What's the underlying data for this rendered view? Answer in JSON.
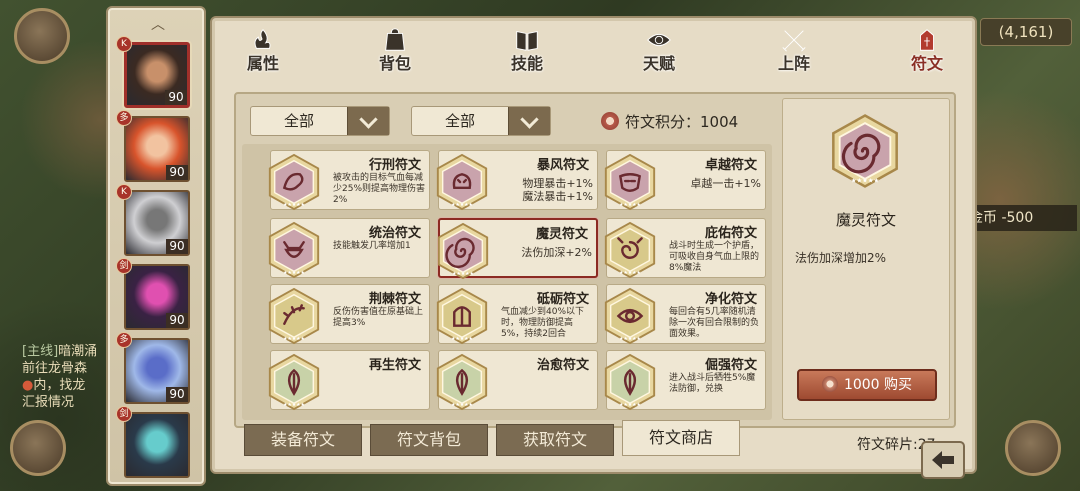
{
  "header": {
    "tabs": [
      {
        "label": "属性",
        "icon": "flame-icon",
        "active": false
      },
      {
        "label": "背包",
        "icon": "backpack-icon",
        "active": false
      },
      {
        "label": "技能",
        "icon": "book-icon",
        "active": false
      },
      {
        "label": "天赋",
        "icon": "eye-icon",
        "active": false
      },
      {
        "label": "上阵",
        "icon": "crossed-swords-icon",
        "active": false
      },
      {
        "label": "符文",
        "icon": "rune-emblem-icon",
        "active": true
      }
    ]
  },
  "background": {
    "quest_tag": "[主线]",
    "quest_title": "暗潮涌",
    "quest_line1": "前往龙骨森",
    "quest_line2": "内，找龙",
    "quest_line3": "汇报情况",
    "gold_readout": "(4,161)",
    "gold_toast": "金币 -500"
  },
  "heroes": [
    {
      "level": "90",
      "badge": "K",
      "selected": true,
      "colors": [
        "#3b2a22",
        "#c8906a"
      ]
    },
    {
      "level": "90",
      "badge": "多",
      "selected": false,
      "colors": [
        "#d8542c",
        "#f2c3a0"
      ]
    },
    {
      "level": "90",
      "badge": "K",
      "selected": false,
      "colors": [
        "#cfcfd2",
        "#777"
      ]
    },
    {
      "level": "90",
      "badge": "剑",
      "selected": false,
      "colors": [
        "#3a2244",
        "#e050b0"
      ]
    },
    {
      "level": "90",
      "badge": "多",
      "selected": false,
      "colors": [
        "#9fb8e8",
        "#5a6dc8"
      ]
    },
    {
      "level": "",
      "badge": "剑",
      "selected": false,
      "colors": [
        "#2a3a4a",
        "#6cc"
      ]
    }
  ],
  "filters": {
    "filter1": "全部",
    "filter2": "全部"
  },
  "points": {
    "label": "符文积分：1004"
  },
  "runes": [
    {
      "name": "行刑符文",
      "desc": "被攻击的目标气血每减少25%则提高物理伤害2%",
      "big": false,
      "color": "#c9a3ac",
      "glyph": "dragon"
    },
    {
      "name": "暴风符文",
      "desc": "物理暴击+1%\n魔法暴击+1%",
      "big": true,
      "color": "#c9a3ac",
      "glyph": "beast"
    },
    {
      "name": "卓越符文",
      "desc": "卓越一击+1%",
      "big": true,
      "color": "#c9a3ac",
      "glyph": "mask"
    },
    {
      "name": "统治符文",
      "desc": "技能触发几率增加1",
      "big": false,
      "color": "#c9a3ac",
      "glyph": "demon"
    },
    {
      "name": "魔灵符文",
      "desc": "法伤加深+2%",
      "big": true,
      "color": "#c9a3ac",
      "glyph": "spiral"
    },
    {
      "name": "庇佑符文",
      "desc": "战斗时生成一个护盾，可吸收自身气血上限的8%魔法",
      "big": false,
      "color": "#d8c98a",
      "glyph": "swirl"
    },
    {
      "name": "荆棘符文",
      "desc": "反伤伤害值在原基础上提高3%",
      "big": false,
      "color": "#d8c98a",
      "glyph": "thorn"
    },
    {
      "name": "砥砺符文",
      "desc": "气血减少到40%以下时，物理防御提高5%，持续2回合",
      "big": false,
      "color": "#d8c98a",
      "glyph": "helm"
    },
    {
      "name": "净化符文",
      "desc": "每回合有5几率随机清除一次有回合限制的负面效果。",
      "big": false,
      "color": "#d8c98a",
      "glyph": "eye"
    },
    {
      "name": "再生符文",
      "desc": "",
      "big": false,
      "color": "#c8d2a8",
      "glyph": "leaf"
    },
    {
      "name": "治愈符文",
      "desc": "",
      "big": false,
      "color": "#c8d2a8",
      "glyph": "leaf"
    },
    {
      "name": "倔强符文",
      "desc": "进入战斗后牺牲5%魔法防御，兑换",
      "big": false,
      "color": "#c8d2a8",
      "glyph": "leaf"
    }
  ],
  "detail": {
    "name": "魔灵符文",
    "desc": "法伤加深增加2%",
    "buy_label": "1000 购买",
    "color": "#c9a3ac"
  },
  "bottom_tabs": [
    {
      "label": "装备符文",
      "active": false
    },
    {
      "label": "符文背包",
      "active": false
    },
    {
      "label": "获取符文",
      "active": false
    },
    {
      "label": "符文商店",
      "active": true
    }
  ],
  "shards": "符文碎片:27"
}
